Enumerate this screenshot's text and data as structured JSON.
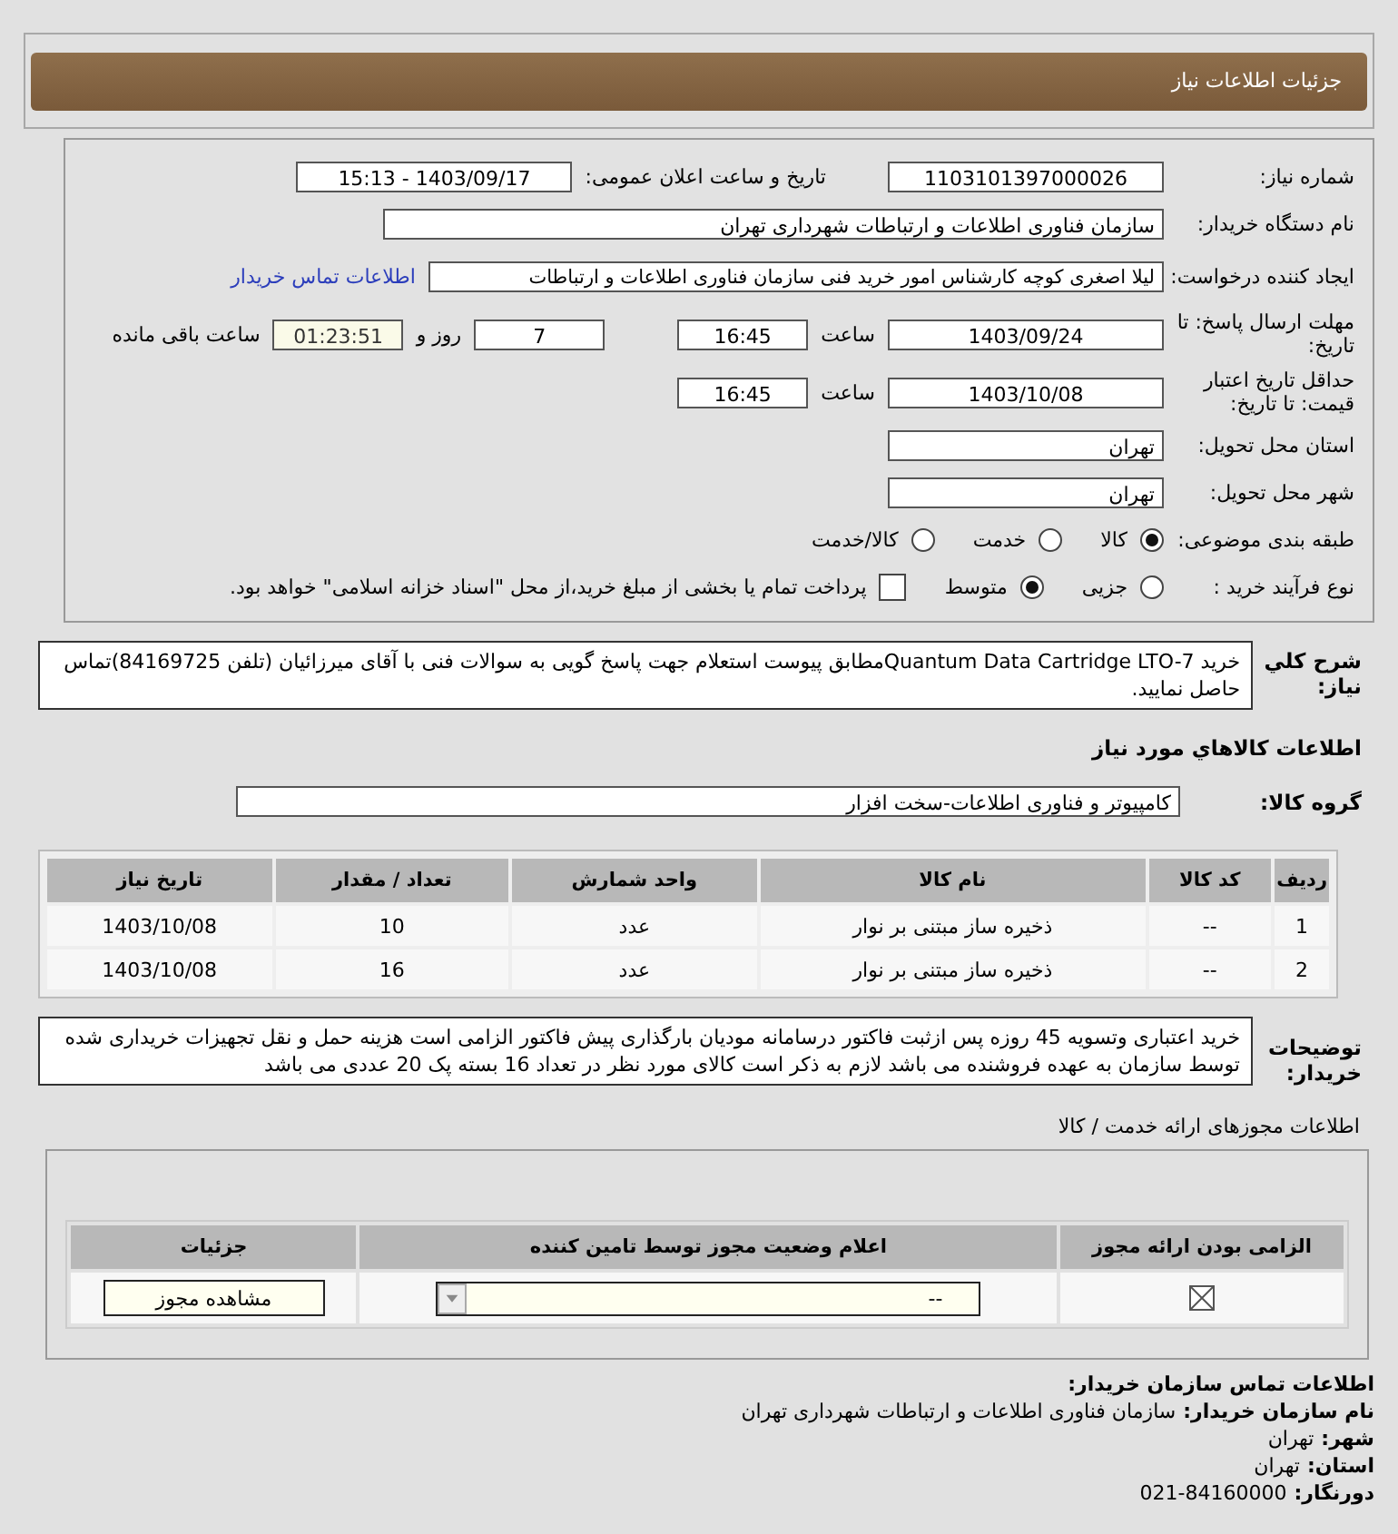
{
  "header": {
    "title": "جزئیات اطلاعات نیاز"
  },
  "form": {
    "need_number": {
      "label": "شماره نیاز:",
      "value": "1103101397000026"
    },
    "announce": {
      "label": "تاریخ و ساعت اعلان عمومی:",
      "value": "1403/09/17 - 15:13"
    },
    "buyer_org": {
      "label": "نام دستگاه خریدار:",
      "value": "سازمان فناوری اطلاعات و ارتباطات شهرداری تهران"
    },
    "requester": {
      "label": "ایجاد کننده درخواست:",
      "value": "لیلا اصغری کوچه کارشناس امور خرید فنی سازمان فناوری اطلاعات و ارتباطات",
      "link": "اطلاعات تماس خریدار"
    },
    "reply_deadline": {
      "label": "مهلت ارسال پاسخ: تا تاریخ:",
      "date": "1403/09/24",
      "time_label": "ساعت",
      "time": "16:45",
      "days": "7",
      "days_label": "روز و",
      "remaining": "01:23:51",
      "remaining_label": "ساعت باقی مانده"
    },
    "price_validity": {
      "label": "حداقل تاریخ اعتبار قیمت: تا تاریخ:",
      "date": "1403/10/08",
      "time_label": "ساعت",
      "time": "16:45"
    },
    "province": {
      "label": "استان محل تحویل:",
      "value": "تهران"
    },
    "city": {
      "label": "شهر محل تحویل:",
      "value": "تهران"
    },
    "category": {
      "label": "طبقه بندی موضوعی:",
      "options": [
        {
          "label": "کالا",
          "selected": true
        },
        {
          "label": "خدمت",
          "selected": false
        },
        {
          "label": "کالا/خدمت",
          "selected": false
        }
      ]
    },
    "process": {
      "label": "نوع فرآیند خرید :",
      "options": [
        {
          "label": "جزیی",
          "selected": false
        },
        {
          "label": "متوسط",
          "selected": true
        }
      ],
      "treasury": {
        "checked": false,
        "label": "پرداخت تمام یا بخشی از مبلغ خرید،از محل \"اسناد خزانه اسلامی\" خواهد بود."
      }
    }
  },
  "description": {
    "label": "شرح کلي نياز:",
    "text": "خرید Quantum Data Cartridge LTO-7مطابق پیوست استعلام جهت پاسخ گویی به سوالات فنی با آقای میرزائیان (تلفن 84169725)تماس حاصل نمایید."
  },
  "goods": {
    "title": "اطلاعات کالاهاي مورد نياز",
    "group_label": "گروه کالا:",
    "group": "کامپیوتر و فناوری اطلاعات-سخت افزار",
    "columns": [
      "ردیف",
      "کد کالا",
      "نام کالا",
      "واحد شمارش",
      "تعداد / مقدار",
      "تاریخ نیاز"
    ],
    "rows": [
      [
        "1",
        "--",
        "ذخیره ساز مبتنی بر نوار",
        "عدد",
        "10",
        "1403/10/08"
      ],
      [
        "2",
        "--",
        "ذخیره ساز مبتنی بر نوار",
        "عدد",
        "16",
        "1403/10/08"
      ]
    ]
  },
  "notes": {
    "label": "توضیحات خریدار:",
    "text": "خرید اعتباری وتسویه 45 روزه پس ازثبت فاکتور درسامانه مودیان بارگذاری پیش فاکتور الزامی است هزینه حمل و نقل تجهیزات خریداری شده توسط سازمان به عهده فروشنده می باشد لازم به ذکر است کالای مورد نظر در تعداد 16 بسته پک 20 عددی می باشد"
  },
  "licenses": {
    "title": "اطلاعات مجوزهای ارائه خدمت / کالا",
    "columns": [
      "الزامی بودن ارائه مجوز",
      "اعلام وضعیت مجوز توسط تامین کننده",
      "جزئیات"
    ],
    "rows": [
      {
        "required": true,
        "status": "--",
        "button": "مشاهده مجوز"
      }
    ]
  },
  "contact": {
    "title": "اطلاعات تماس سازمان خریدار:",
    "items": [
      {
        "label": "نام سازمان خریدار:",
        "value": "سازمان فناوری اطلاعات و ارتباطات شهرداری تهران"
      },
      {
        "label": "شهر:",
        "value": "تهران"
      },
      {
        "label": "استان:",
        "value": "تهران"
      },
      {
        "label": "دورنگار:",
        "value": "84160000-021"
      }
    ]
  }
}
